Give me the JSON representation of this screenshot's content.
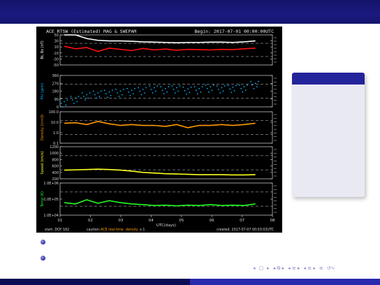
{
  "chart_panel": {
    "title_left": "ACE RTSW (Estimated) MAG & SWEPAM",
    "title_right": "Begin: 2017-07-01 00:00:00UTC",
    "x_ticks": [
      "01",
      "02",
      "03",
      "04",
      "05",
      "06",
      "07",
      "08"
    ],
    "x_label": "UTC(days)",
    "footer_left": "start: DOY 182",
    "footer_mid_1": "caution:",
    "footer_mid_2": "ACE real-time",
    "footer_mid_3": "density",
    "footer_mid_4": "x 1",
    "footer_right": "created: 2017-07-07 00:03:03UTC",
    "colors": {
      "bt": "#ffffff",
      "bz": "#ff1010",
      "phi": "#00b4ff",
      "density": "#ff9a00",
      "speed": "#ffff20",
      "temp": "#20ff20",
      "axes": "#d8d8d8"
    }
  },
  "nav_icons": [
    "nav-first-icon",
    "nav-prev-icon",
    "nav-section-prev-icon",
    "nav-section-next-icon",
    "nav-subsection-icon",
    "nav-next-icon",
    "nav-last-icon",
    "nav-align-icon",
    "nav-search-icon"
  ],
  "chart_data": [
    {
      "type": "line",
      "ylabel": "Bt, Bz (nT)",
      "yticks": [
        "50",
        "30",
        "10",
        "-10",
        "-30",
        "-50"
      ],
      "ylim": [
        -50,
        50
      ],
      "series": [
        {
          "name": "Bt",
          "values": [
            55,
            50,
            38,
            32,
            30,
            30,
            29,
            27,
            26,
            25,
            24,
            25,
            25,
            26,
            26,
            25,
            27,
            30
          ]
        },
        {
          "name": "Bz",
          "values": [
            12,
            4,
            8,
            -5,
            6,
            2,
            -2,
            5,
            0,
            3,
            -1,
            2,
            1,
            0,
            2,
            1,
            4,
            6
          ]
        }
      ]
    },
    {
      "type": "scatter",
      "ylabel": "Phi (gsm)",
      "yticks": [
        "360",
        "270",
        "180",
        "90",
        "0"
      ],
      "ylim": [
        0,
        360
      ],
      "series": [
        {
          "values": [
            40,
            80,
            120,
            140,
            150,
            160,
            170,
            180,
            200,
            190,
            200,
            185,
            190,
            210,
            200,
            205,
            210,
            250
          ]
        }
      ]
    },
    {
      "type": "line",
      "ylabel": "Density (/cm3)",
      "log_y": true,
      "yticks": [
        "100.0",
        "10.0",
        "1.0",
        "0.1"
      ],
      "ylim": [
        0.1,
        100
      ],
      "series": [
        {
          "values": [
            8,
            9,
            6,
            12,
            7,
            5,
            6,
            5,
            5,
            4,
            6,
            3,
            5,
            5,
            6,
            5,
            6,
            8
          ]
        }
      ]
    },
    {
      "type": "line",
      "ylabel": "Speed (km/s)",
      "yticks": [
        "1200",
        "1000",
        "800",
        "600",
        "400",
        "200"
      ],
      "ylim": [
        200,
        1200
      ],
      "series": [
        {
          "values": [
            470,
            480,
            490,
            500,
            490,
            470,
            440,
            400,
            380,
            360,
            350,
            340,
            330,
            330,
            330,
            320,
            320,
            330
          ]
        }
      ]
    },
    {
      "type": "line",
      "ylabel": "Temp (K)",
      "log_y": true,
      "yticks": [
        "1.0E+06",
        "1.0E+05",
        "1.0E+04"
      ],
      "ylim": [
        10000,
        1000000
      ],
      "series": [
        {
          "values": [
            60000,
            50000,
            90000,
            55000,
            80000,
            60000,
            50000,
            45000,
            40000,
            42000,
            38000,
            42000,
            40000,
            45000,
            40000,
            42000,
            40000,
            50000
          ]
        }
      ]
    }
  ]
}
